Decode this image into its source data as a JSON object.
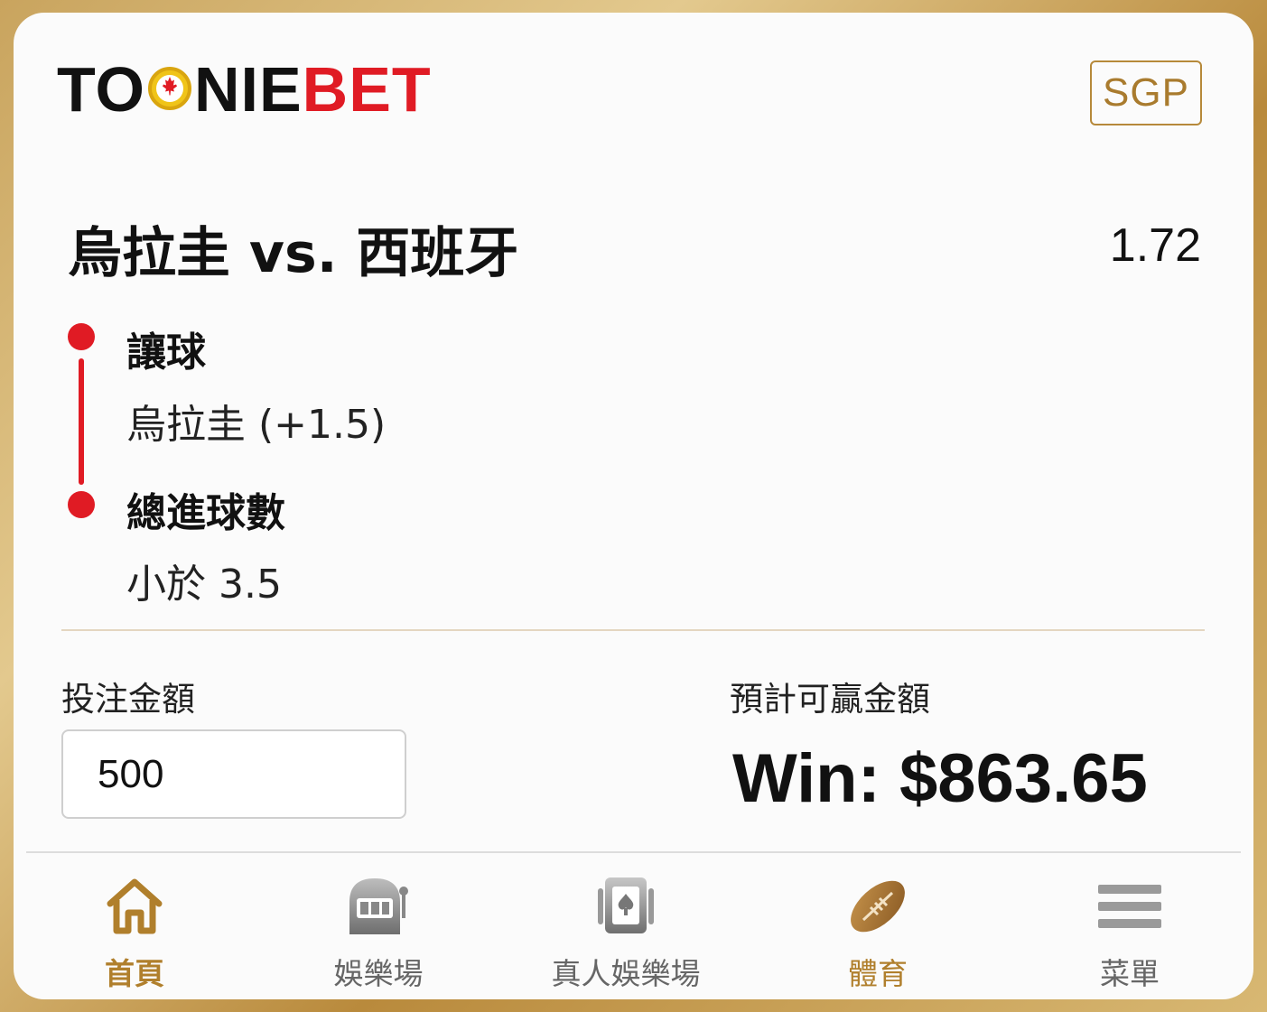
{
  "brand": {
    "logo_text_black_1": "TO",
    "logo_text_black_2": "NIE",
    "logo_text_red": "BET",
    "badge": "SGP"
  },
  "bet": {
    "match_title": "烏拉圭 vs. 西班牙",
    "odds": "1.72",
    "legs": [
      {
        "market": "讓球",
        "selection": "烏拉圭 (+1.5)"
      },
      {
        "market": "總進球數",
        "selection": "小於 3.5"
      }
    ]
  },
  "stake": {
    "label": "投注金額",
    "value": "500"
  },
  "payout": {
    "label": "預計可贏金額",
    "amount": "Win: $863.65"
  },
  "nav": {
    "items": [
      {
        "label": "首頁",
        "icon": "home-icon",
        "active": true
      },
      {
        "label": "娛樂場",
        "icon": "slot-machine-icon",
        "active": false
      },
      {
        "label": "真人娛樂場",
        "icon": "playing-card-icon",
        "active": false
      },
      {
        "label": "體育",
        "icon": "football-icon",
        "active": false
      },
      {
        "label": "菜單",
        "icon": "menu-icon",
        "active": false
      }
    ]
  },
  "colors": {
    "accent_red": "#e01b24",
    "gold": "#b07f2c",
    "text": "#111111"
  }
}
